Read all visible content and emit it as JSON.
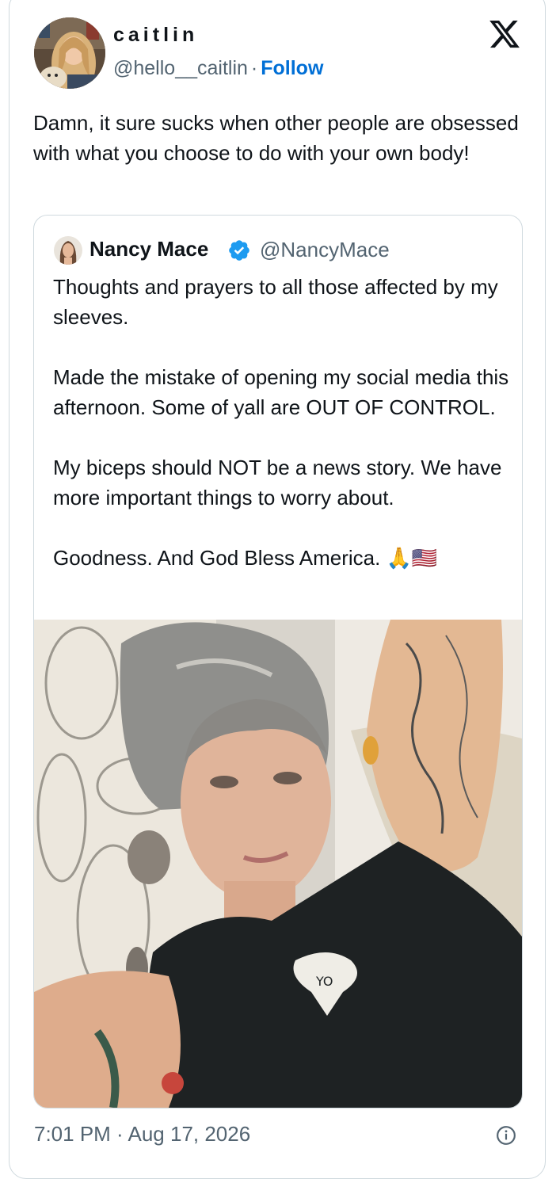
{
  "tweet": {
    "author": {
      "display_name": "caitlin",
      "handle": "@hello__caitlin",
      "avatar_icon": "profile-photo-avatar"
    },
    "separator": "·",
    "follow_label": "Follow",
    "logo_icon": "x-logo-icon",
    "text": "Damn, it sure sucks when other people are obsessed with what you choose to do with your own body!",
    "timestamp": "7:01 PM · Aug 17, 2026",
    "info_icon": "info-icon"
  },
  "quoted_tweet": {
    "author": {
      "display_name": "Nancy Mace",
      "handle": "@NancyMace",
      "verified": true,
      "verified_icon": "verified-badge-icon"
    },
    "paragraphs": [
      "Thoughts and prayers to all those affected by my sleeves.",
      "Made the mistake of opening my social media this afternoon. Some of yall are OUT OF CONTROL.",
      "My biceps should NOT be a news story. We have more important things to worry about.",
      "Goodness. And God Bless America. 🙏🇺🇸"
    ],
    "media": {
      "kind": "photo",
      "icon": "selfie-photo",
      "shirt_print": "YO"
    }
  },
  "colors": {
    "text_primary": "#0f1419",
    "text_secondary": "#536471",
    "link_blue": "#006fd6",
    "verified_blue": "#1d9bf0",
    "border": "#cfd9de"
  }
}
